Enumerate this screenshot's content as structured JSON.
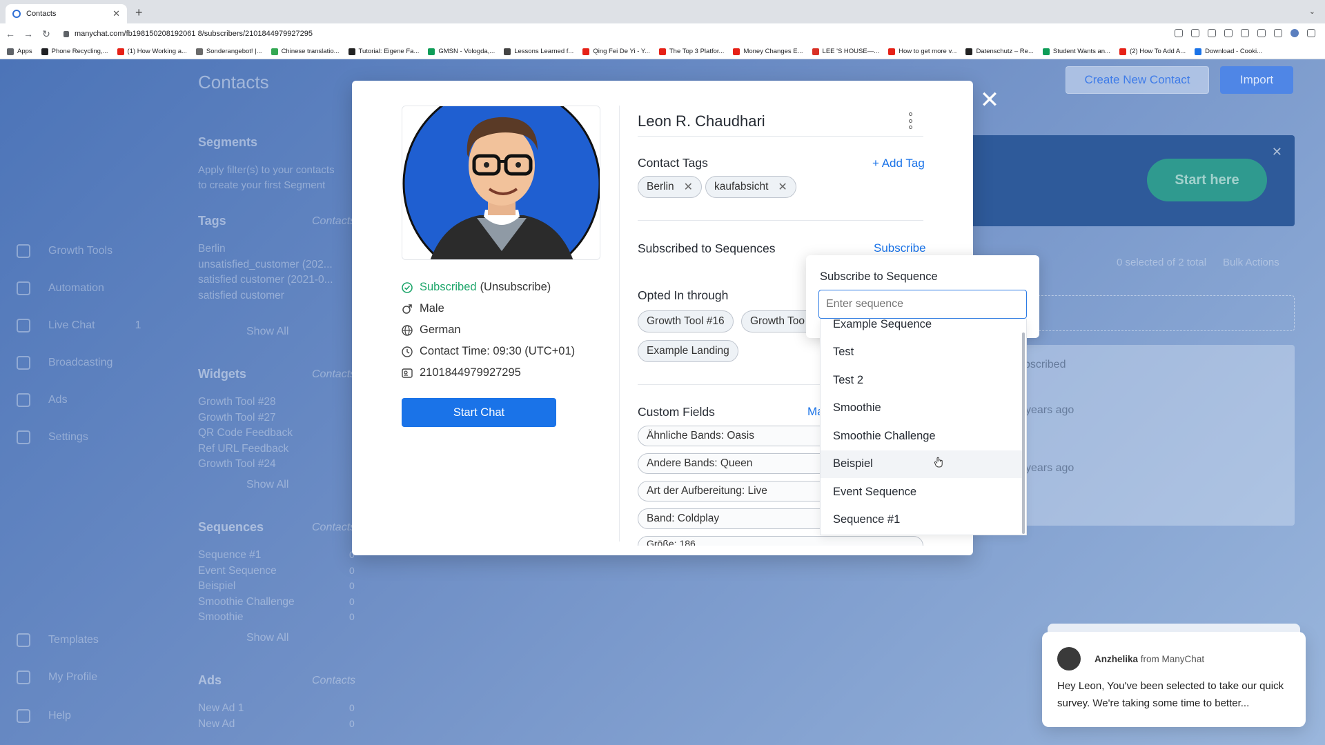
{
  "browser": {
    "tab_title": "Contacts",
    "url": "manychat.com/fb198150208192061 8/subscribers/2101844979927295",
    "bookmarks": [
      {
        "label": "Apps",
        "color": "#5f6368"
      },
      {
        "label": "Phone Recycling,...",
        "color": "#202124"
      },
      {
        "label": "(1) How Working a...",
        "color": "#e62117"
      },
      {
        "label": "Sonderangebot! |...",
        "color": "#6a6a6a"
      },
      {
        "label": "Chinese translatio...",
        "color": "#34a853"
      },
      {
        "label": "Tutorial: Eigene Fa...",
        "color": "#222222"
      },
      {
        "label": "GMSN - Vologda,...",
        "color": "#0f9d58"
      },
      {
        "label": "Lessons Learned f...",
        "color": "#444444"
      },
      {
        "label": "Qing Fei De Yi - Y...",
        "color": "#e62117"
      },
      {
        "label": "The Top 3 Platfor...",
        "color": "#e62117"
      },
      {
        "label": "Money Changes E...",
        "color": "#e62117"
      },
      {
        "label": "LEE 'S HOUSE—...",
        "color": "#d93025"
      },
      {
        "label": "How to get more v...",
        "color": "#e62117"
      },
      {
        "label": "Datenschutz – Re...",
        "color": "#222222"
      },
      {
        "label": "Student Wants an...",
        "color": "#0f9d58"
      },
      {
        "label": "(2) How To Add A...",
        "color": "#e62117"
      },
      {
        "label": "Download - Cooki...",
        "color": "#1a73e8"
      }
    ]
  },
  "background": {
    "page_title": "Contacts",
    "create_contact": "Create New Contact",
    "import": "Import",
    "start_here": "Start here",
    "selected_info": "0 selected of 2 total",
    "bulk_actions": "Bulk Actions",
    "subscribed_frag": "bscribed",
    "years_ago_1": "years ago",
    "years_ago_2": "years ago",
    "segments": "Segments",
    "segments_hint_1": "Apply filter(s) to your contacts",
    "segments_hint_2": "to create your first Segment",
    "tags": "Tags",
    "tags_col": "Contacts",
    "tag_items": [
      "Berlin",
      "unsatisfied_customer (202...",
      "satisfied customer (2021-0...",
      "satisfied customer"
    ],
    "show_all_1": "Show All",
    "widgets": "Widgets",
    "widgets_col": "Contacts",
    "widget_items": [
      "Growth Tool #28",
      "Growth Tool #27",
      "QR Code Feedback",
      "Ref URL Feedback",
      "Growth Tool #24"
    ],
    "show_all_2": "Show All",
    "sequences": "Sequences",
    "sequences_col": "Contacts",
    "sequence_items": [
      "Sequence #1",
      "Event Sequence",
      "Beispiel",
      "Smoothie Challenge",
      "Smoothie"
    ],
    "sequence_counts": [
      "0",
      "0",
      "0",
      "0",
      "0"
    ],
    "show_all_3": "Show All",
    "ads": "Ads",
    "ads_col": "Contacts",
    "ad_items": [
      "New Ad 1",
      "New Ad"
    ],
    "ad_counts": [
      "0",
      "0"
    ],
    "sidebar": [
      "Growth Tools",
      "Automation",
      "Live Chat",
      "Broadcasting",
      "Ads",
      "Settings",
      "Templates",
      "My Profile",
      "Help"
    ],
    "live_chat_count": "1"
  },
  "contact": {
    "name": "Leon R. Chaudhari",
    "status": "Subscribed",
    "unsubscribe": "(Unsubscribe)",
    "gender": "Male",
    "language": "German",
    "contact_time": "Contact Time:  09:30 (UTC+01)",
    "id": "2101844979927295",
    "start_chat": "Start Chat",
    "contact_tags_title": "Contact Tags",
    "add_tag": "+ Add Tag",
    "tags": [
      "Berlin",
      "kaufabsicht"
    ],
    "sequences_title": "Subscribed to Sequences",
    "subscribe": "Subscribe",
    "opted_in_title": "Opted In through",
    "opted_in": [
      "Growth Tool #16",
      "Growth Too",
      "Example Landing"
    ],
    "custom_fields_title": "Custom Fields",
    "custom_fields_link": "Ma",
    "custom_fields": [
      "Ähnliche Bands: Oasis",
      "Andere Bands: Queen",
      "Art der Aufbereitung: Live",
      "Band: Coldplay",
      "Größe: 186"
    ]
  },
  "dropdown": {
    "title": "Subscribe to Sequence",
    "placeholder": "Enter sequence",
    "options": [
      "Example Sequence",
      "Test",
      "Test 2",
      "Smoothie",
      "Smoothie Challenge",
      "Beispiel",
      "Event Sequence",
      "Sequence #1"
    ],
    "hovered": "Beispiel"
  },
  "chat_popup": {
    "sender": "Anzhelika",
    "from_label": "from ManyChat",
    "message": "Hey Leon,  You've been selected to take our quick survey. We're taking some time to better..."
  },
  "colors": {
    "accent": "#1a73e8",
    "subscribed": "#1ea66b"
  }
}
